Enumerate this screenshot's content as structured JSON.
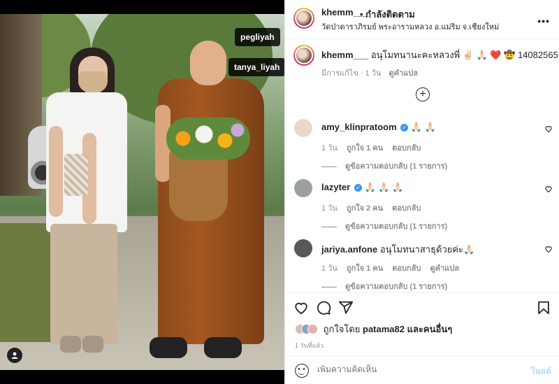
{
  "media": {
    "tags": [
      "pegliyah",
      "tanya_liyah"
    ]
  },
  "header": {
    "username": "khemm___",
    "follow_label": "• กำลังติดตาม",
    "location": "วัดป่าดาราภิรมย์ พระอารามหลวง อ.แม่ริม จ.เชียงใหม่",
    "more_label": "•••"
  },
  "caption": {
    "username": "khemm___",
    "text": "อนุโมทนานะคะหลวงพี่ ✌🏻 🙏🏻 ❤️ 🤠 14082565",
    "edited": "มีการแก้ไข · 1 วัน",
    "translate": "ดูคำแปล"
  },
  "comments": [
    {
      "username": "amy_klinpratoom",
      "verified": true,
      "text": "🙏🏻 🙏🏻",
      "time": "1 วัน",
      "likes": "ถูกใจ 1 คน",
      "reply": "ตอบกลับ",
      "translate": "",
      "replies": "ดูข้อความตอบกลับ (1 รายการ)",
      "avatar_color": "#e8d9cf"
    },
    {
      "username": "lazyter",
      "verified": true,
      "text": "🙏🏻 🙏🏻 🙏🏻",
      "time": "1 วัน",
      "likes": "ถูกใจ 2 คน",
      "reply": "ตอบกลับ",
      "translate": "",
      "replies": "ดูข้อความตอบกลับ (1 รายการ)",
      "avatar_color": "#9aa0a0"
    },
    {
      "username": "jariya.anfone",
      "verified": false,
      "text": "อนุโมทนาสาธุด้วยค่ะ🙏🏻",
      "time": "1 วัน",
      "likes": "ถูกใจ 1 คน",
      "reply": "ตอบกลับ",
      "translate": "ดูคำแปล",
      "replies": "ดูข้อความตอบกลับ (1 รายการ)",
      "avatar_color": "#5a5856"
    }
  ],
  "likes": {
    "text_prefix": "ถูกใจโดย ",
    "user": "patama82",
    "text_suffix": " และคนอื่นๆ"
  },
  "time": "1 วันที่แล้ว",
  "add_comment": {
    "placeholder": "เพิ่มความคิดเห็น",
    "post": "โพสต์"
  },
  "icons": [
    "heart-icon",
    "comment-icon",
    "share-icon",
    "bookmark-icon",
    "emoji-icon",
    "add-icon",
    "user-tag-icon"
  ],
  "colors": {
    "verified": "#3897f0",
    "post_button": "#b2dffc",
    "like_heart": "#ed4956"
  }
}
